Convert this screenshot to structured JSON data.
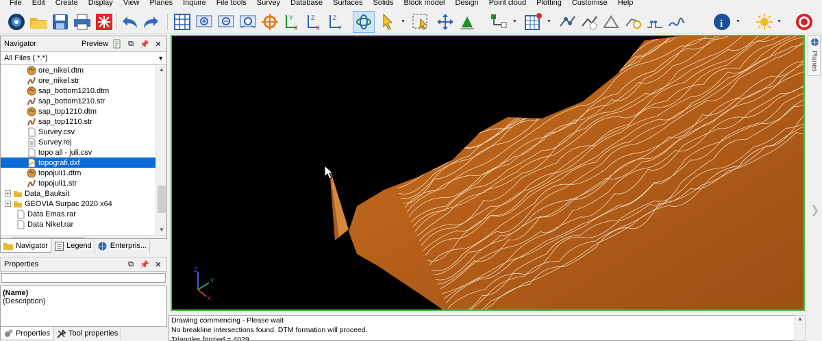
{
  "menu": [
    "File",
    "Edit",
    "Create",
    "Display",
    "View",
    "Planes",
    "Inquire",
    "File tools",
    "Survey",
    "Database",
    "Surfaces",
    "Solids",
    "Block model",
    "Design",
    "Point cloud",
    "Plotting",
    "Customise",
    "Help"
  ],
  "navigator": {
    "title": "Navigator",
    "preview_label": "Preview",
    "filter": "All Files (.*.*)",
    "items": [
      {
        "label": "ore_nikel.dtm",
        "icon": "dtm-file-icon",
        "indent": 2
      },
      {
        "label": "ore_nikel.str",
        "icon": "str-file-icon",
        "indent": 2
      },
      {
        "label": "sap_bottom1210.dtm",
        "icon": "dtm-file-icon",
        "indent": 2
      },
      {
        "label": "sap_bottom1210.str",
        "icon": "str-file-icon",
        "indent": 2
      },
      {
        "label": "sap_top1210.dtm",
        "icon": "dtm-file-icon",
        "indent": 2
      },
      {
        "label": "sap_top1210.str",
        "icon": "str-file-icon",
        "indent": 2
      },
      {
        "label": "Survey.csv",
        "icon": "text-file-icon",
        "indent": 2
      },
      {
        "label": "Survey.rej",
        "icon": "rej-file-icon",
        "indent": 2
      },
      {
        "label": "topo all - juli.csv",
        "icon": "text-file-icon",
        "indent": 2
      },
      {
        "label": "topografi.dxf",
        "icon": "dxf-file-icon",
        "indent": 2,
        "selected": true
      },
      {
        "label": "topojuli1.dtm",
        "icon": "dtm-file-icon",
        "indent": 2
      },
      {
        "label": "topojuli1.str",
        "icon": "str-file-icon",
        "indent": 2
      },
      {
        "label": "Data_Bauksit",
        "icon": "folder-icon",
        "indent": 0,
        "expander": "+"
      },
      {
        "label": "GEOVIA Surpac 2020 x64",
        "icon": "folder-icon",
        "indent": 0,
        "expander": "+"
      },
      {
        "label": "Data Emas.rar",
        "icon": "text-file-icon",
        "indent": 1
      },
      {
        "label": "Data Nikel.rar",
        "icon": "text-file-icon",
        "indent": 1
      }
    ],
    "tabs": [
      {
        "label": "Navigator",
        "icon": "folder-icon",
        "active": true
      },
      {
        "label": "Legend",
        "icon": "legend-icon",
        "active": false
      },
      {
        "label": "Enterpris...",
        "icon": "globe-icon",
        "active": false
      }
    ]
  },
  "properties": {
    "title": "Properties",
    "name_label": "(Name)",
    "description_label": "(Description)",
    "tabs": [
      {
        "label": "Properties",
        "icon": "properties-icon"
      },
      {
        "label": "Tool properties",
        "icon": "tools-icon"
      }
    ]
  },
  "viewport": {
    "axis_labels": {
      "z": "Z",
      "y": "Y",
      "x": "X"
    }
  },
  "side_tab": {
    "label": "Planes"
  },
  "console": {
    "lines": [
      "Drawing commencing - Please wait",
      "No breakline intersections found. DTM formation will proceed.",
      "Triangles formed = 4029"
    ]
  },
  "colors": {
    "accent_selection": "#0a6cd8",
    "viewport_border": "#3ec43e",
    "terrain": "#b8611c",
    "contour": "#fff2d8"
  }
}
